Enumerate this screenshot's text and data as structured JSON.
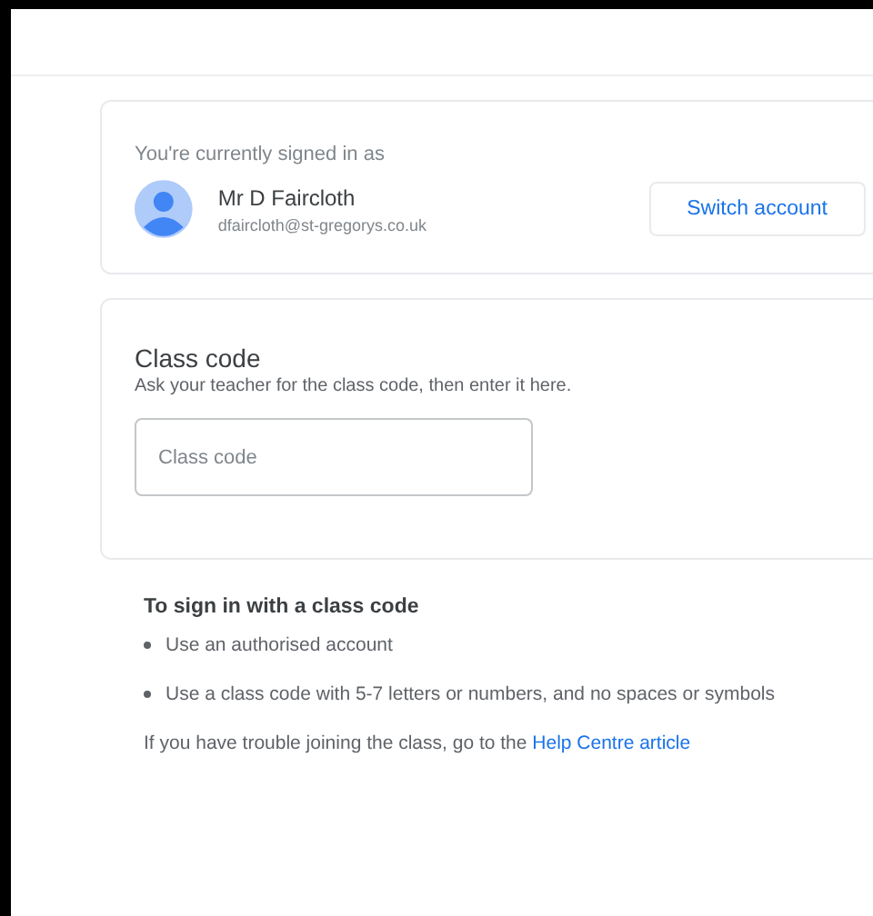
{
  "account": {
    "caption": "You're currently signed in as",
    "name": "Mr D Faircloth",
    "email": "dfaircloth@st-gregorys.co.uk",
    "button": "Switch account"
  },
  "class_code": {
    "title": "Class code",
    "hint": "Ask your teacher for the class code, then enter it here.",
    "placeholder": "Class code"
  },
  "help": {
    "heading": "To sign in with a class code",
    "bullets": [
      "Use an authorised account",
      "Use a class code with 5-7 letters or numbers, and no spaces or symbols"
    ],
    "trouble": "If you have trouble joining the class, go to the ",
    "link": "Help Centre article"
  }
}
